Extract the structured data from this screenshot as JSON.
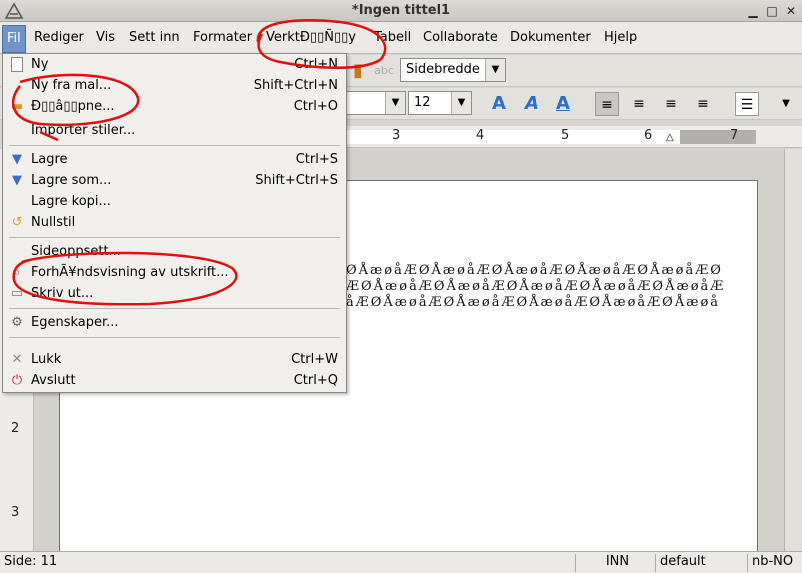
{
  "window": {
    "title": "*Ingen tittel1"
  },
  "menubar": {
    "items": [
      "Fil",
      "Rediger",
      "Vis",
      "Sett inn",
      "Formater",
      "VerktÐ▯▯Ñ▯▯y",
      "Tabell",
      "Collaborate",
      "Dokumenter",
      "Hjelp"
    ]
  },
  "toolbar": {
    "zoom_value": "Sidebredde",
    "font_size_value": "12"
  },
  "ruler": {
    "numbers": [
      "3",
      "4",
      "5",
      "6",
      "7"
    ]
  },
  "vruler": {
    "numbers": [
      "2",
      "3"
    ]
  },
  "document": {
    "lines": [
      "ØÅæøåÆØÅæøåÆØÅæøåÆØÅæøåÆØÅæøåÆØ",
      "ÆØÅæøåÆØÅæøåÆØÅæøåÆØÅæøåÆØÅæøåÆ",
      "åÆØÅæøåÆØÅæøåÆØÅæøåÆØÅæøåÆØÅæøå"
    ]
  },
  "statusbar": {
    "page": "Side: 11",
    "insert_mode": "INN",
    "style": "default",
    "language": "nb-NO"
  },
  "file_menu": {
    "items": [
      {
        "label": "Ny",
        "shortcut": "Ctrl+N",
        "icon": "new-document-icon"
      },
      {
        "label": "Ny fra mal...",
        "shortcut": "Shift+Ctrl+N",
        "icon": ""
      },
      {
        "label": "Ð▯▯â▯▯pne...",
        "shortcut": "Ctrl+O",
        "icon": "open-folder-icon"
      },
      {
        "label": "Importer stiler...",
        "shortcut": "",
        "icon": ""
      },
      {
        "label": "Lagre",
        "shortcut": "Ctrl+S",
        "icon": "save-icon"
      },
      {
        "label": "Lagre som...",
        "shortcut": "Shift+Ctrl+S",
        "icon": "save-as-icon"
      },
      {
        "label": "Lagre kopi...",
        "shortcut": "",
        "icon": ""
      },
      {
        "label": "Nullstil",
        "shortcut": "",
        "icon": "revert-icon"
      },
      {
        "label": "Sideoppsett...",
        "shortcut": "",
        "icon": ""
      },
      {
        "label": "ForhÃ¥ndsvisning av utskrift...",
        "shortcut": "",
        "icon": "print-preview-icon"
      },
      {
        "label": "Skriv ut...",
        "shortcut": "",
        "icon": "print-icon"
      },
      {
        "label": "Egenskaper...",
        "shortcut": "",
        "icon": "properties-icon"
      },
      {
        "label": "Lukk",
        "shortcut": "Ctrl+W",
        "icon": "close-icon"
      },
      {
        "label": "Avslutt",
        "shortcut": "Ctrl+Q",
        "icon": "quit-icon"
      }
    ]
  },
  "colors": {
    "menu_highlight": "#6e93c4",
    "annotation": "#e01010"
  }
}
